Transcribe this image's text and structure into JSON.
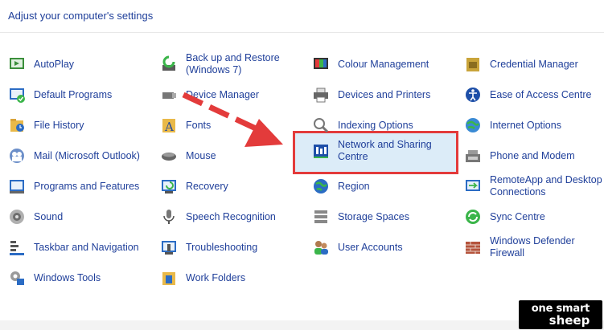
{
  "header": {
    "title": "Adjust your computer's settings"
  },
  "columns": [
    [
      "AutoPlay",
      "Default Programs",
      "File History",
      "Mail (Microsoft Outlook)",
      "Programs and Features",
      "Sound",
      "Taskbar and Navigation",
      "Windows Tools"
    ],
    [
      "Back up and Restore\n(Windows 7)",
      "Device Manager",
      "Fonts",
      "Mouse",
      "Recovery",
      "Speech Recognition",
      "Troubleshooting",
      "Work Folders"
    ],
    [
      "Colour Management",
      "Devices and Printers",
      "Indexing Options",
      "Network and Sharing\nCentre",
      "Region",
      "Storage Spaces",
      "User Accounts"
    ],
    [
      "Credential Manager",
      "Ease of Access Centre",
      "Internet Options",
      "Phone and Modem",
      "RemoteApp and Desktop\nConnections",
      "Sync Centre",
      "Windows Defender\nFirewall"
    ]
  ],
  "icons": {
    "col0": [
      "autoplay-icon",
      "default-programs-icon",
      "file-history-icon",
      "mail-icon",
      "programs-features-icon",
      "sound-icon",
      "taskbar-icon",
      "windows-tools-icon"
    ],
    "col1": [
      "backup-icon",
      "device-manager-icon",
      "fonts-icon",
      "mouse-icon",
      "recovery-icon",
      "microphone-icon",
      "troubleshooting-icon",
      "work-folders-icon"
    ],
    "col2": [
      "colour-management-icon",
      "printer-icon",
      "indexing-icon",
      "network-icon",
      "globe-icon",
      "storage-icon",
      "users-icon"
    ],
    "col3": [
      "credential-icon",
      "ease-of-access-icon",
      "internet-options-icon",
      "phone-modem-icon",
      "remoteapp-icon",
      "sync-icon",
      "firewall-icon"
    ]
  },
  "highlight": {
    "item": "Network and Sharing Centre",
    "color": "#e33b3b"
  },
  "logo": {
    "line1": "one smart",
    "line2": "sheep"
  },
  "colors": {
    "link": "#1f3f9a",
    "annotation_red": "#e33b3b",
    "selection_bg": "#dcecf8"
  }
}
